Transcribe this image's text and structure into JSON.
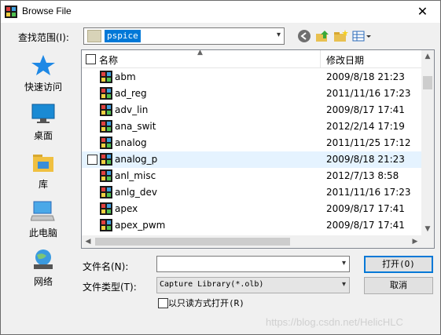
{
  "window": {
    "title": "Browse File",
    "close_glyph": "✕"
  },
  "toolbar": {
    "lookin_label": "查找范围(I):",
    "lookin_value": "pspice",
    "icons": [
      "back-icon",
      "up-folder-icon",
      "new-folder-icon",
      "view-menu-icon"
    ]
  },
  "places": [
    {
      "name": "quick-access",
      "label": "快速访问"
    },
    {
      "name": "desktop",
      "label": "桌面"
    },
    {
      "name": "library",
      "label": "库"
    },
    {
      "name": "this-pc",
      "label": "此电脑"
    },
    {
      "name": "network",
      "label": "网络"
    }
  ],
  "filelist": {
    "col_name": "名称",
    "col_date": "修改日期",
    "rows": [
      {
        "name": "abm",
        "date": "2009/8/18 21:23"
      },
      {
        "name": "ad_reg",
        "date": "2011/11/16 17:23"
      },
      {
        "name": "adv_lin",
        "date": "2009/8/17 17:41"
      },
      {
        "name": "ana_swit",
        "date": "2012/2/14 17:19"
      },
      {
        "name": "analog",
        "date": "2011/11/25 17:12"
      },
      {
        "name": "analog_p",
        "date": "2009/8/18 21:23",
        "hover": true
      },
      {
        "name": "anl_misc",
        "date": "2012/7/13 8:58"
      },
      {
        "name": "anlg_dev",
        "date": "2011/11/16 17:23"
      },
      {
        "name": "apex",
        "date": "2009/8/17 17:41"
      },
      {
        "name": "apex_pwm",
        "date": "2009/8/17 17:41"
      }
    ]
  },
  "form": {
    "filename_label": "文件名(N):",
    "filename_value": "",
    "filetype_label": "文件类型(T):",
    "filetype_value": "Capture Library(*.olb)",
    "open_button": "打开(O)",
    "cancel_button": "取消",
    "readonly_label": "以只读方式打开(R)"
  },
  "watermark": "https://blog.csdn.net/HelicHLC"
}
